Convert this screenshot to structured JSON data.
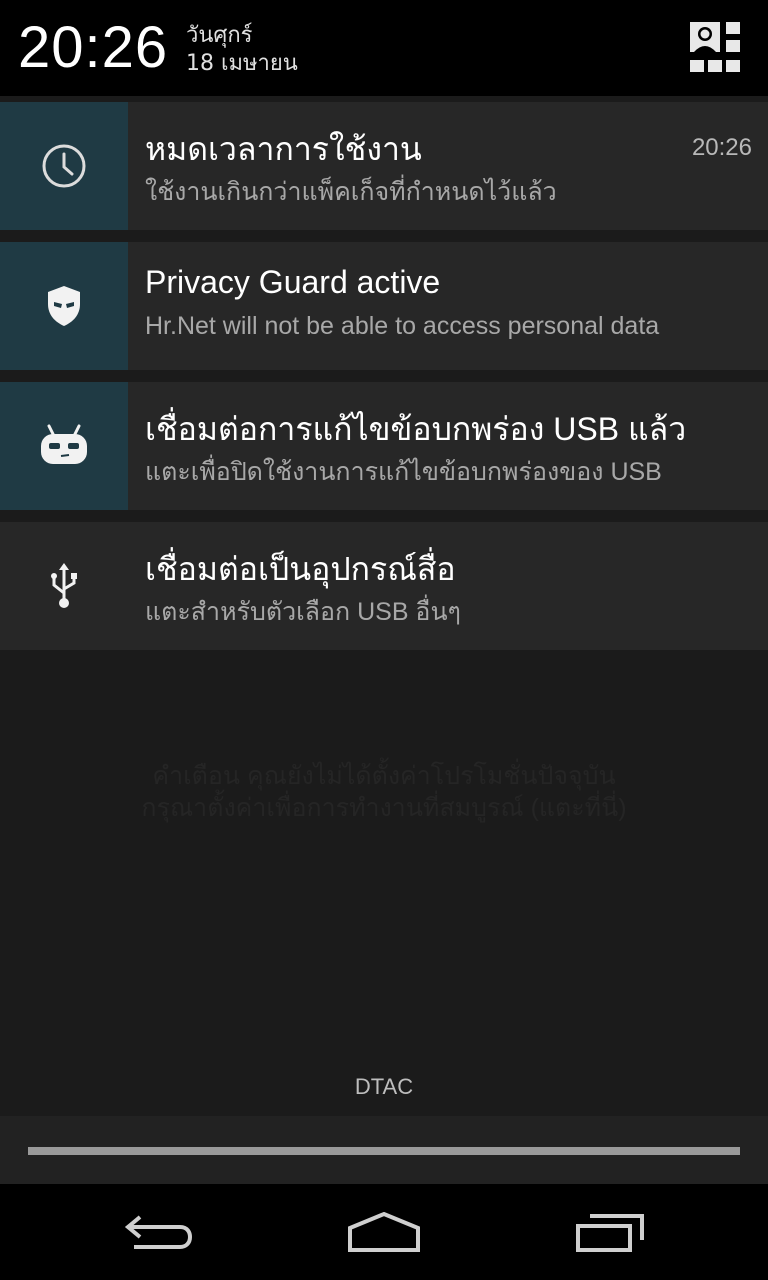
{
  "status": {
    "time": "20:26",
    "day": "วันศุกร์",
    "date": "18 เมษายน"
  },
  "notifications": [
    {
      "icon": "clock-icon",
      "title": "หมดเวลาการใช้งาน",
      "text": "ใช้งานเกินกว่าแพ็คเก็จที่กำหนดไว้แล้ว",
      "time": "20:26"
    },
    {
      "icon": "privacy-guard-shield-icon",
      "title": "Privacy Guard active",
      "text": "Hr.Net will not be able to access personal data"
    },
    {
      "icon": "cyanogenmod-cid-icon",
      "title": "เชื่อมต่อการแก้ไขข้อบกพร่อง USB แล้ว",
      "text": "แตะเพื่อปิดใช้งานการแก้ไขข้อบกพร่องของ USB"
    },
    {
      "icon": "usb-icon",
      "title": "เชื่อมต่อเป็นอุปกรณ์สื่อ",
      "text": "แตะสำหรับตัวเลือก USB อื่นๆ"
    }
  ],
  "background_warning": {
    "line1": "คำเตือน คุณยังไม่ได้ตั้งค่าโปรโมชั่นปัจจุบัน",
    "line2": "กรุณาตั้งค่าเพื่อการทำงานที่สมบูรณ์ (แตะที่นี่)"
  },
  "carrier": "DTAC",
  "navbar": {
    "back": "back-icon",
    "home": "home-icon",
    "recents": "recents-icon"
  },
  "colors": {
    "accent_icon_bg": "#1f3a44",
    "notification_bg": "#272727",
    "panel_bg": "#1b1b1b"
  }
}
